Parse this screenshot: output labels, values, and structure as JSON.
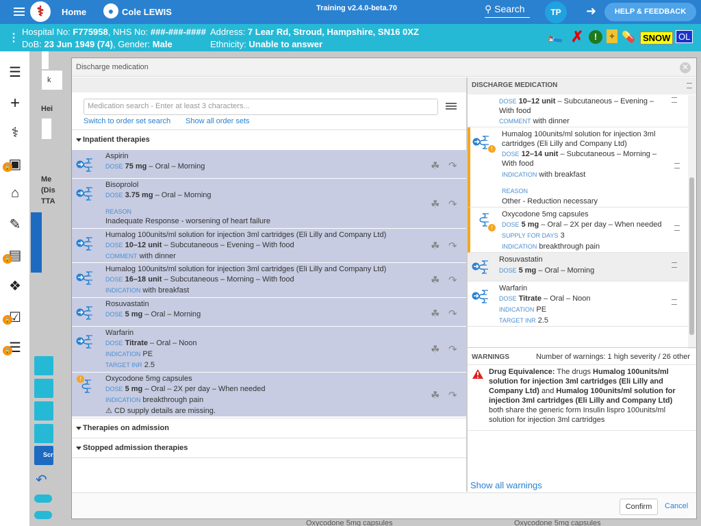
{
  "topbar": {
    "logo": "⚕",
    "home": "Home",
    "patient_name": "Cole LEWIS",
    "training": "Training v2.4.0-beta.70",
    "search": "Search",
    "avatar": "TP",
    "help": "HELP & FEEDBACK"
  },
  "patient": {
    "hospital_label": "Hospital No: ",
    "hospital_no": "F775958",
    "nhs_label": ", NHS No: ",
    "nhs_no": "###-###-####",
    "dob_label": "DoB: ",
    "dob": "23 Jun 1949 (74)",
    "gender_label": ", Gender: ",
    "gender": "Male",
    "address_label": "Address: ",
    "address": "7 Lear Rd, Stroud, Hampshire, SN16 0XZ",
    "ethnicity_label": "Ethnicity: ",
    "ethnicity": "Unable to answer",
    "badge_snow": "SNOW",
    "badge_ol": "OL"
  },
  "background": {
    "frag1": "k",
    "frag2": "Hei",
    "frag3": "Me",
    "frag4": "(Dis",
    "frag5": "TTA",
    "frag6": "Scr",
    "under1": "Oxycodone 5mg capsules",
    "under2": "Oxycodone 5mg capsules"
  },
  "modal": {
    "title": "Discharge medication",
    "search_placeholder": "Medication search - Enter at least 3 characters...",
    "switch_link": "Switch to order set search",
    "show_all_link": "Show all order sets",
    "inpatient_section": "Inpatient therapies",
    "admission_section": "Therapies on admission",
    "stopped_section": "Stopped admission therapies",
    "lbl_dose": "DOSE",
    "lbl_reason": "REASON",
    "lbl_comment": "COMMENT",
    "lbl_indication": "INDICATION",
    "lbl_target": "TARGET INR",
    "lbl_supply": "SUPPLY FOR DAYS",
    "confirm": "Confirm",
    "cancel": "Cancel"
  },
  "inpatient": [
    {
      "name": "Aspirin",
      "dose": "75 mg",
      "rest": " – Oral – Morning"
    },
    {
      "name": "Bisoprolol",
      "dose": "3.75 mg",
      "rest": " – Oral – Morning",
      "reason": "Inadequate Response - worsening of heart failure"
    },
    {
      "name": "Humalog 100units/ml solution for injection 3ml cartridges (Eli Lilly and Company Ltd)",
      "dose": "10–12 unit",
      "rest": " – Subcutaneous – Evening – With food",
      "comment": "with dinner"
    },
    {
      "name": "Humalog 100units/ml solution for injection 3ml cartridges (Eli Lilly and Company Ltd)",
      "dose": "16–18 unit",
      "rest": " – Subcutaneous – Morning – With food",
      "indication": "with breakfast"
    },
    {
      "name": "Rosuvastatin",
      "dose": "5 mg",
      "rest": " – Oral – Morning"
    },
    {
      "name": "Warfarin",
      "dose": "Titrate",
      "rest": " – Oral – Noon",
      "indication": "PE",
      "target": "2.5"
    },
    {
      "name": "Oxycodone 5mg capsules",
      "dose": "5 mg",
      "rest": " – Oral – 2X per day – When needed",
      "indication": "breakthrough pain",
      "warning": "CD supply details are missing."
    }
  ],
  "discharge": {
    "header": "DISCHARGE MEDICATION",
    "items": [
      {
        "dose": "10–12 unit",
        "rest": " – Subcutaneous – Evening – With food",
        "comment": "with dinner"
      },
      {
        "name": "Humalog 100units/ml solution for injection 3ml cartridges (Eli Lilly and Company Ltd)",
        "dose": "12–14 unit",
        "rest": " – Subcutaneous – Morning – With food",
        "indication": "with breakfast",
        "reason": "Other - Reduction necessary"
      },
      {
        "name": "Oxycodone 5mg capsules",
        "dose": "5 mg",
        "rest": " – Oral – 2X per day – When needed",
        "supply": "3",
        "indication": "breakthrough pain"
      },
      {
        "name": "Rosuvastatin",
        "dose": "5 mg",
        "rest": " – Oral – Morning"
      },
      {
        "name": "Warfarin",
        "dose": "Titrate",
        "rest": " – Oral – Noon",
        "indication": "PE",
        "target": "2.5"
      }
    ]
  },
  "warnings": {
    "title": "WARNINGS",
    "count": "Number of warnings: 1 high severity / 26 other",
    "item_title": "Drug Equivalence:",
    "t1": " The drugs ",
    "drug1": "Humalog 100units/ml solution for injection 3ml cartridges (Eli Lilly and Company Ltd)",
    "t2": " and ",
    "drug2": "Humalog 100units/ml solution for injection 3ml cartridges (Eli Lilly and Company Ltd)",
    "t3": "both share the generic form Insulin lispro 100units/ml solution for injection 3ml cartridges",
    "show_all": "Show all warnings"
  },
  "colors": {
    "topbar": "#2a81d0",
    "patient_bar": "#26b9d6",
    "row_highlight": "#c7cce2",
    "warning_accent": "#f5a623",
    "link": "#2a81d0"
  }
}
